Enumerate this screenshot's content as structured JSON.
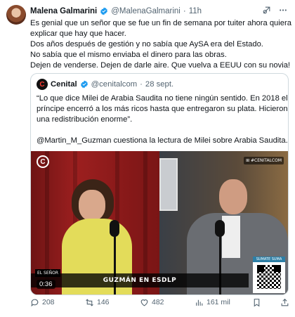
{
  "author": {
    "name": "Malena Galmarini",
    "handle": "@MalenaGalmarini",
    "separator": "·",
    "time": "11h"
  },
  "tweet_lines": [
    "Es genial que un señor que se fue un fin de semana por tuiter ahora quiera",
    "explicar que hay que hacer.",
    "Dos años después de gestión y no sabía que AySA era del Estado.",
    "No sabía que el mismo enviaba el dinero para las obras.",
    "Dejen de venderse. Dejen de darle aire. Que vuelva a EEUU con su novia!"
  ],
  "quote": {
    "logo_letter": "C",
    "name": "Cenital",
    "handle": "@cenitalcom",
    "separator": "·",
    "date": "28 sept.",
    "lines": [
      "“Lo que dice Milei de Arabia Saudita no tiene ningún sentido. En 2018 el",
      "príncipe encerró a los más ricos hasta que entregaron su plata. Hicieron",
      "una redistribución enorme”."
    ],
    "line_after": "@Martin_M_Guzman cuestiona la lectura de Milei sobre Arabia Saudita...",
    "video": {
      "logo": "C",
      "hashtag": "⊞ #CENITALCOM",
      "show_tag": "EL SEÑOR",
      "banner": "GUZMÁN EN ESDLP",
      "duration": "0:36",
      "qr_label": "SUMATE SUMA"
    }
  },
  "actions": {
    "replies": "208",
    "retweets": "146",
    "likes": "482",
    "views": "161 mil"
  },
  "colors": {
    "verified": "#1d9bf0",
    "muted": "#536471",
    "border": "#cfd9de"
  }
}
